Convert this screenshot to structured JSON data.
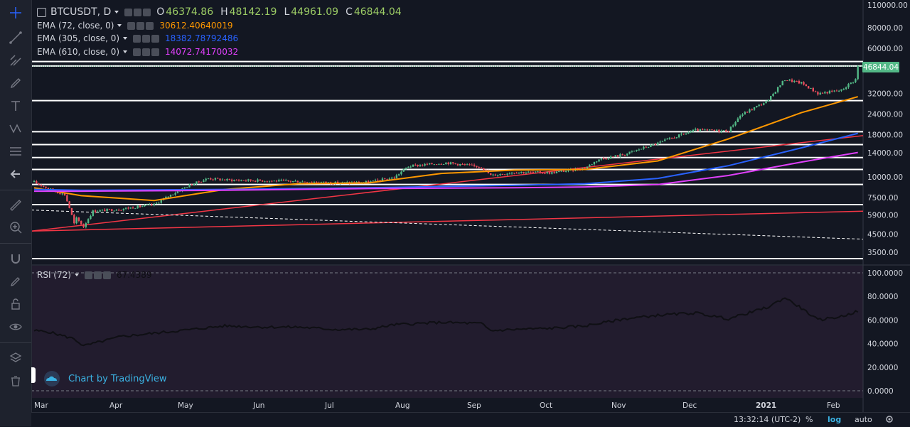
{
  "symbol_header": {
    "symbol": "BTCUSDT, D",
    "open_label": "O",
    "open_value": "46374.86",
    "high_label": "H",
    "high_value": "48142.19",
    "low_label": "L",
    "low_value": "44961.09",
    "close_label": "C",
    "close_value": "46844.04"
  },
  "indicators": [
    {
      "label": "EMA (72, close, 0)",
      "value": "30612.40640019",
      "color": "#ff9800"
    },
    {
      "label": "EMA (305, close, 0)",
      "value": "18382.78792486",
      "color": "#2962ff"
    },
    {
      "label": "EMA (610, close, 0)",
      "value": "14072.74170032",
      "color": "#e040fb"
    }
  ],
  "rsi": {
    "label": "RSI (72)",
    "value": "67.4389"
  },
  "colors": {
    "background": "#131722",
    "up": "#53b987",
    "down": "#eb4d5c",
    "ema72": "#ff9800",
    "ema305": "#2962ff",
    "ema610": "#e040fb",
    "trend": "#f23645",
    "rsi_bg": "#221c2e",
    "rsi_line": "#0f0f14",
    "accent": "#3bb3e4"
  },
  "price_badge": "46844.04",
  "watermark": "Chart by TradingView",
  "footer": {
    "time": "13:32:14 (UTC-2)",
    "percent": "%",
    "log": "log",
    "auto": "auto"
  },
  "toolbar_icons": [
    "crosshair-icon",
    "trend-line-icon",
    "pitchfork-icon",
    "brush-icon",
    "text-icon",
    "pattern-icon",
    "fib-icon",
    "back-arrow-icon",
    "ruler-icon",
    "zoom-in-icon",
    "magnet-icon",
    "lock-draw-icon",
    "lock-icon",
    "eye-icon",
    "layers-icon",
    "trash-icon"
  ],
  "chart_data": [
    {
      "type": "candlestick",
      "title": "BTCUSDT, D",
      "scale": "log",
      "x_labels": [
        "Mar",
        "Apr",
        "May",
        "Jun",
        "Jul",
        "Aug",
        "Sep",
        "Oct",
        "Nov",
        "Dec",
        "2021",
        "Feb"
      ],
      "y_ticks": [
        "110000.00",
        "80000.00",
        "60000.00",
        "46844.04",
        "32000.00",
        "24000.00",
        "18000.00",
        "14000.00",
        "10000.00",
        "7500.00",
        "5900.00",
        "4500.00",
        "3500.00"
      ],
      "x_dates": [
        "2020-02-24",
        "2020-03-01",
        "2020-03-08",
        "2020-03-12",
        "2020-03-13",
        "2020-03-16",
        "2020-03-20",
        "2020-04-01",
        "2020-04-15",
        "2020-04-30",
        "2020-05-08",
        "2020-05-15",
        "2020-06-01",
        "2020-06-15",
        "2020-07-01",
        "2020-07-15",
        "2020-07-26",
        "2020-08-01",
        "2020-08-17",
        "2020-09-01",
        "2020-09-05",
        "2020-09-15",
        "2020-10-01",
        "2020-10-15",
        "2020-10-21",
        "2020-11-01",
        "2020-11-15",
        "2020-12-01",
        "2020-12-15",
        "2020-12-20",
        "2021-01-01",
        "2021-01-08",
        "2021-01-15",
        "2021-01-22",
        "2021-02-01",
        "2021-02-07",
        "2021-02-08"
      ],
      "close": [
        9300,
        8500,
        7800,
        5200,
        5600,
        5000,
        6200,
        6400,
        6800,
        8900,
        9800,
        9600,
        9500,
        9400,
        9200,
        9300,
        9900,
        11600,
        12200,
        11500,
        10200,
        10700,
        10600,
        11300,
        12800,
        13700,
        16000,
        19200,
        19000,
        23500,
        29000,
        39000,
        37000,
        32000,
        33500,
        39000,
        46844
      ],
      "ylim": [
        3100,
        110000
      ],
      "horizontal_levels": [
        50000,
        47000,
        29000,
        18800,
        15700,
        13100,
        11100,
        9000,
        6800,
        3200
      ],
      "series": [
        {
          "name": "EMA (72, close, 0)",
          "x": [
            "2020-02-24",
            "2020-03-15",
            "2020-04-15",
            "2020-05-15",
            "2020-06-15",
            "2020-07-15",
            "2020-08-15",
            "2020-09-15",
            "2020-10-15",
            "2020-11-15",
            "2020-12-15",
            "2021-01-15",
            "2021-02-08"
          ],
          "values": [
            8600,
            7700,
            7200,
            8400,
            9100,
            9200,
            10500,
            11000,
            11100,
            12500,
            17000,
            24500,
            30612
          ]
        },
        {
          "name": "EMA (305, close, 0)",
          "x": [
            "2020-02-24",
            "2020-03-15",
            "2020-05-15",
            "2020-07-15",
            "2020-09-15",
            "2020-10-15",
            "2020-11-15",
            "2020-12-15",
            "2021-01-15",
            "2021-02-08"
          ],
          "values": [
            8400,
            8300,
            8400,
            8600,
            8900,
            9100,
            9800,
            11700,
            15000,
            18383
          ]
        },
        {
          "name": "EMA (610, close, 0)",
          "x": [
            "2020-02-24",
            "2020-03-15",
            "2020-05-15",
            "2020-07-15",
            "2020-09-15",
            "2020-10-15",
            "2020-11-15",
            "2020-12-15",
            "2021-01-15",
            "2021-02-08"
          ],
          "values": [
            8200,
            8200,
            8300,
            8500,
            8600,
            8700,
            9000,
            10200,
            12300,
            14072
          ]
        }
      ]
    },
    {
      "type": "line",
      "title": "RSI (72)",
      "y_ticks": [
        "100.0000",
        "80.0000",
        "60.0000",
        "40.0000",
        "20.0000",
        "0.0000"
      ],
      "ylim": [
        0,
        100
      ],
      "x": [
        "2020-02-24",
        "2020-03-01",
        "2020-03-12",
        "2020-03-16",
        "2020-04-01",
        "2020-05-01",
        "2020-05-15",
        "2020-06-01",
        "2020-06-15",
        "2020-07-01",
        "2020-07-15",
        "2020-07-26",
        "2020-08-15",
        "2020-09-01",
        "2020-09-05",
        "2020-09-15",
        "2020-10-01",
        "2020-10-15",
        "2020-11-01",
        "2020-11-15",
        "2020-12-01",
        "2020-12-15",
        "2021-01-01",
        "2021-01-08",
        "2021-01-15",
        "2021-01-22",
        "2021-02-01",
        "2021-02-08"
      ],
      "values": [
        51,
        50,
        44,
        38,
        46,
        52,
        55,
        54,
        54,
        52,
        52,
        56,
        58,
        57,
        51,
        52,
        53,
        55,
        61,
        64,
        66,
        61,
        71,
        79,
        70,
        60,
        63,
        67.4389
      ]
    }
  ]
}
